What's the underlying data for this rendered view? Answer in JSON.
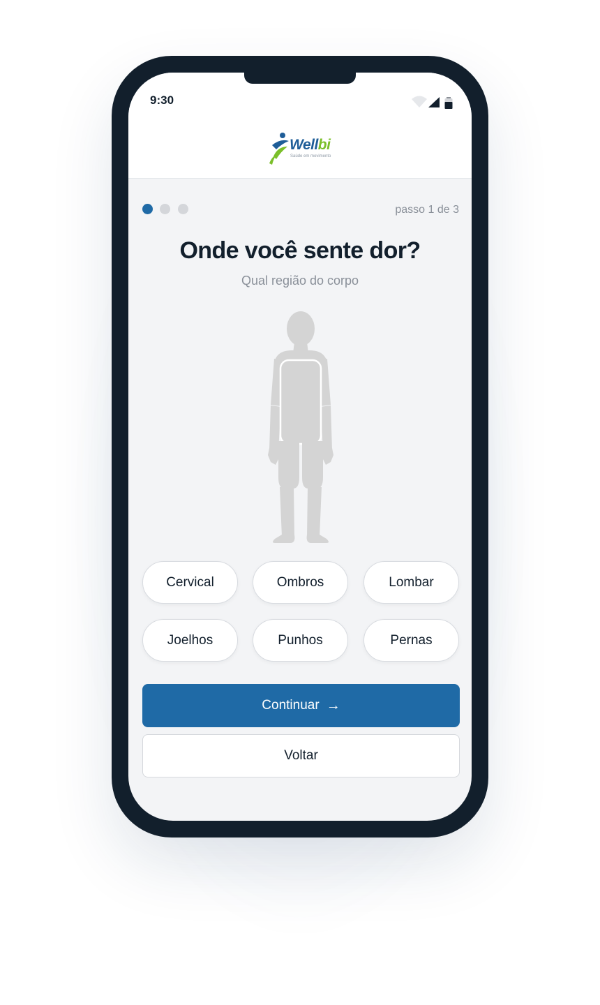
{
  "status_bar": {
    "time": "9:30",
    "icons": [
      "wifi-icon",
      "signal-icon",
      "battery-icon"
    ]
  },
  "brand": {
    "name_part1": "Well",
    "name_part2": "bi",
    "tagline": "Saúde em movimento",
    "colors": {
      "blue": "#1e5d98",
      "green": "#7bbf2a"
    }
  },
  "progress": {
    "current_step": 1,
    "total_steps": 3,
    "label": "passo 1 de 3"
  },
  "question": {
    "title": "Onde você sente dor?",
    "subtitle": "Qual região do corpo"
  },
  "body_map": {
    "icon": "human-body-icon",
    "highlighted_region": "torso"
  },
  "regions": [
    "Cervical",
    "Ombros",
    "Lombar",
    "Joelhos",
    "Punhos",
    "Pernas"
  ],
  "actions": {
    "continue_label": "Continuar",
    "continue_arrow": "→",
    "back_label": "Voltar"
  },
  "colors": {
    "primary": "#1f6aa6",
    "frame": "#121f2c",
    "screen_bg": "#f3f4f6",
    "figure": "#d4d4d4"
  }
}
